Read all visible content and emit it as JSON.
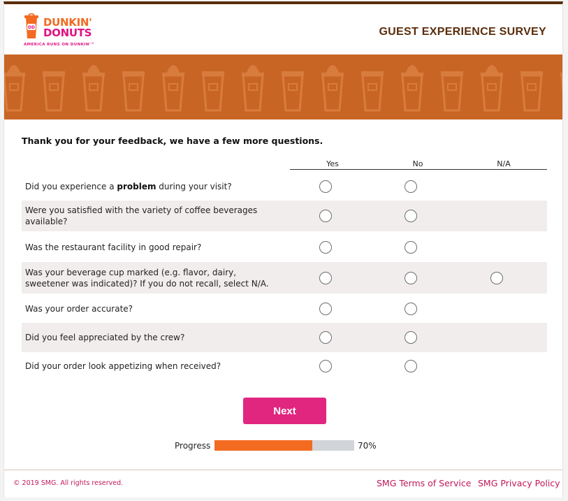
{
  "brand": {
    "line1": "DUNKIN'",
    "line2": "DONUTS",
    "tagline": "AMERICA RUNS ON DUNKIN'™",
    "cup_text": "DD",
    "colors": {
      "orange": "#f26b21",
      "pink": "#e11383",
      "brown": "#5a2d0c",
      "banner": "#c96524"
    }
  },
  "header": {
    "title": "GUEST EXPERIENCE SURVEY"
  },
  "intro": "Thank you for your feedback, we have a few more questions.",
  "columns": [
    "Yes",
    "No",
    "N/A"
  ],
  "questions": [
    {
      "pre": "Did you experience a ",
      "bold": "problem",
      "post": " during your visit?",
      "options": [
        "yes",
        "no"
      ]
    },
    {
      "pre": "Were you satisfied with the variety of coffee beverages available?",
      "bold": "",
      "post": "",
      "options": [
        "yes",
        "no"
      ]
    },
    {
      "pre": "Was the restaurant facility in good repair?",
      "bold": "",
      "post": "",
      "options": [
        "yes",
        "no"
      ]
    },
    {
      "pre": "Was your beverage cup marked (e.g. flavor, dairy, sweetener was indicated)? If you do not recall, select N/A.",
      "bold": "",
      "post": "",
      "options": [
        "yes",
        "no",
        "na"
      ]
    },
    {
      "pre": "Was your order accurate?",
      "bold": "",
      "post": "",
      "options": [
        "yes",
        "no"
      ]
    },
    {
      "pre": "Did you feel appreciated by the crew?",
      "bold": "",
      "post": "",
      "options": [
        "yes",
        "no"
      ]
    },
    {
      "pre": "Did your order look appetizing when received?",
      "bold": "",
      "post": "",
      "options": [
        "yes",
        "no"
      ]
    }
  ],
  "next_button": "Next",
  "progress": {
    "label": "Progress",
    "value": 0.7,
    "text": "70%"
  },
  "footer": {
    "copyright": "© 2019 SMG. All rights reserved.",
    "terms": "SMG Terms of Service",
    "privacy": "SMG Privacy Policy"
  }
}
